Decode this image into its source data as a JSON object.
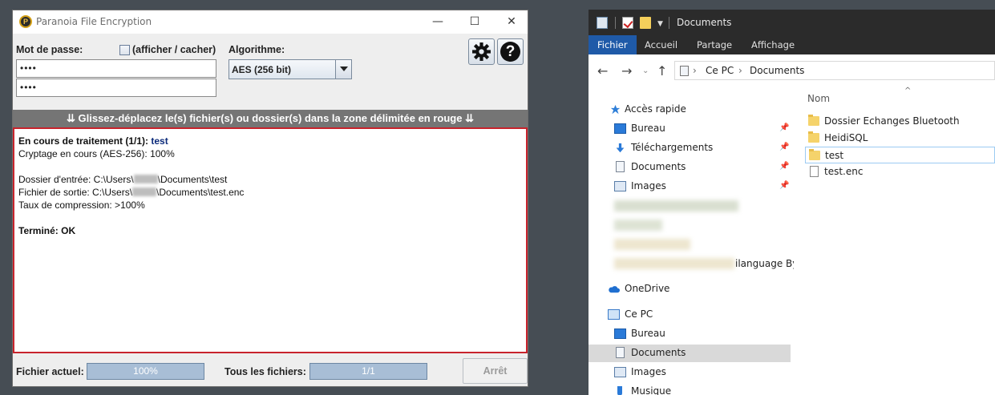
{
  "paranoia": {
    "title": "Paranoia File Encryption",
    "window_controls": {
      "minimize": "—",
      "maximize": "☐",
      "close": "✕"
    },
    "password_label": "Mot de passe:",
    "show_hide_label": "(afficher / cacher)",
    "password_value": "••••",
    "password_confirm_value": "••••",
    "algorithm_label": "Algorithme:",
    "algorithm_value": "AES (256 bit)",
    "help_glyph": "?",
    "drop_banner": "⇊ Glissez-déplacez le(s) fichier(s) ou dossier(s) dans la zone délimitée en rouge ⇊",
    "log": {
      "processing_prefix": "En cours de traitement (1/1):",
      "processing_file": "test",
      "encrypting": "Cryptage en cours (AES-256): 100%",
      "input_prefix": "Dossier d'entrée: C:\\Users\\",
      "input_suffix": "\\Documents\\test",
      "output_prefix": "Fichier de sortie: C:\\Users\\",
      "output_suffix": "\\Documents\\test.enc",
      "compression": "Taux de compression: >100%",
      "done": "Terminé: OK"
    },
    "current_file_label": "Fichier actuel:",
    "current_file_progress": "100%",
    "all_files_label": "Tous les fichiers:",
    "all_files_progress": "1/1",
    "stop_button": "Arrêt"
  },
  "explorer": {
    "title": "Documents",
    "ribbon_tabs": [
      "Fichier",
      "Accueil",
      "Partage",
      "Affichage"
    ],
    "nav": {
      "back": "←",
      "forward": "→",
      "recent": "⌄",
      "up": "↑"
    },
    "breadcrumb": [
      "Ce PC",
      "Documents"
    ],
    "breadcrumb_sep": "›",
    "sidebar": {
      "quick_access": "Accès rapide",
      "items": [
        "Bureau",
        "Téléchargements",
        "Documents",
        "Images"
      ],
      "blurred_partial": "ilanguage By",
      "onedrive": "OneDrive",
      "this_pc": "Ce PC",
      "pc_items": [
        "Bureau",
        "Documents",
        "Images",
        "Musique"
      ],
      "pin_glyph": "📌"
    },
    "column_name": "Nom",
    "sort_glyph": "^",
    "files": [
      "Dossier Echanges Bluetooth",
      "HeidiSQL",
      "test",
      "test.enc"
    ]
  },
  "colors": {
    "dropzone_border": "#c8232c",
    "banner_bg": "#757575",
    "progress_fill": "#a8bed6",
    "ribbon_active": "#1f5aa8",
    "desktop_bg": "#464d54"
  }
}
